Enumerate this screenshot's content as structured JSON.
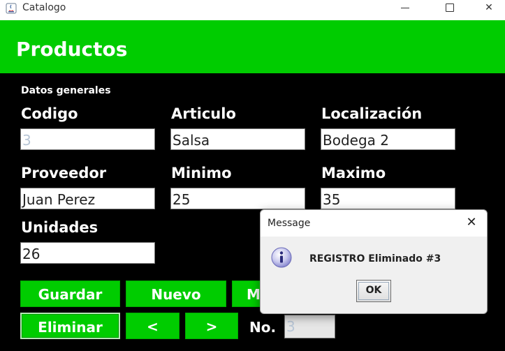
{
  "window": {
    "title": "Catalogo",
    "controls": {
      "minimize": "—",
      "maximize": "☐",
      "close": "✕"
    }
  },
  "header": {
    "title": "Productos"
  },
  "form": {
    "section_label": "Datos generales",
    "labels": {
      "codigo": "Codigo",
      "articulo": "Articulo",
      "localizacion": "Localización",
      "proveedor": "Proveedor",
      "minimo": "Minimo",
      "maximo": "Maximo",
      "unidades": "Unidades"
    },
    "values": {
      "codigo": "3",
      "articulo": "Salsa",
      "localizacion": "Bodega 2",
      "proveedor": "Juan Perez",
      "minimo": "25",
      "maximo": "35",
      "unidades": "26"
    }
  },
  "buttons": {
    "guardar": "Guardar",
    "nuevo": "Nuevo",
    "modificar_partial": "M",
    "eliminar": "Eliminar",
    "prev": "<",
    "next": ">"
  },
  "navigation": {
    "no_label": "No.",
    "no_value": "3"
  },
  "dialog": {
    "title": "Message",
    "message": "REGISTRO Eliminado #3",
    "ok_label": "OK",
    "close_glyph": "✕"
  },
  "colors": {
    "header_green": "#00cc00",
    "background": "#000000",
    "button_green": "#00cc00"
  }
}
